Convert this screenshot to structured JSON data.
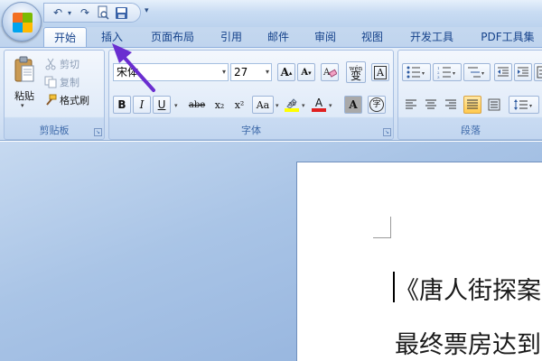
{
  "quick_access": {
    "icons": [
      "undo-icon",
      "redo-icon",
      "print-preview-icon",
      "save-icon"
    ],
    "customize_glyph": "▾"
  },
  "tabs": [
    {
      "label": "开始",
      "active": true
    },
    {
      "label": "插入",
      "active": false
    },
    {
      "label": "页面布局",
      "active": false
    },
    {
      "label": "引用",
      "active": false
    },
    {
      "label": "邮件",
      "active": false
    },
    {
      "label": "审阅",
      "active": false
    },
    {
      "label": "视图",
      "active": false
    },
    {
      "label": "开发工具",
      "active": false
    },
    {
      "label": "PDF工具集",
      "active": false
    }
  ],
  "clipboard": {
    "label": "剪贴板",
    "paste": "粘贴",
    "cut": "剪切",
    "copy": "复制",
    "format_painter": "格式刷"
  },
  "font": {
    "label": "字体",
    "font_name": "宋体",
    "font_size": "27",
    "buttons": [
      "B",
      "I",
      "U",
      "abe",
      "x₂",
      "x²",
      "Aa"
    ],
    "grow_glyph": "A",
    "shrink_glyph": "A",
    "phonetic": "wén",
    "phonetic_char": "变",
    "text_color_glyph": "A",
    "char_shading_glyph": "A",
    "enclose_glyph": "字"
  },
  "paragraph": {
    "label": "段落"
  },
  "document": {
    "lines": [
      "《唐人街探案",
      "最终票房达到"
    ]
  },
  "colors": {
    "accent_highlight": "#ffff00",
    "font_color": "#e02020",
    "arrow": "#6a2ed0"
  }
}
